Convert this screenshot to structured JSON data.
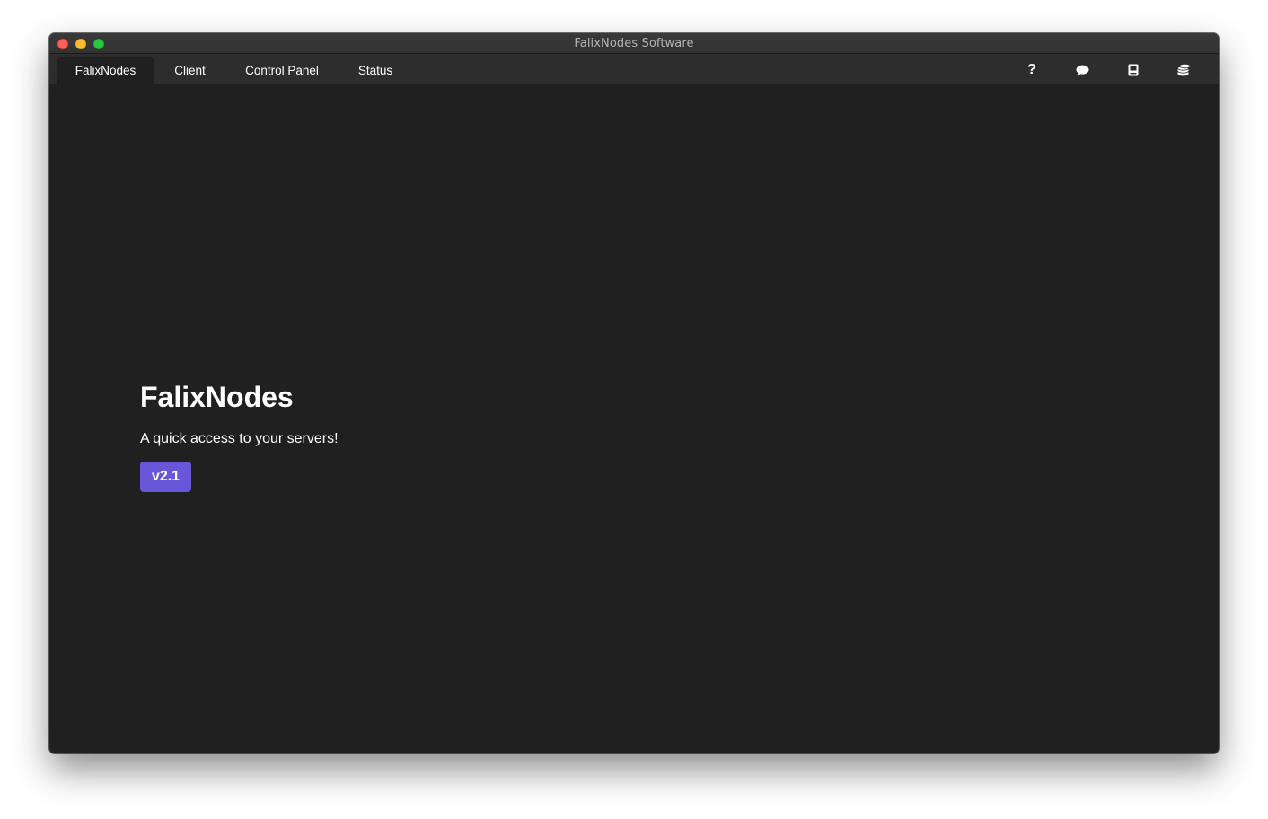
{
  "window": {
    "title": "FalixNodes Software"
  },
  "nav": {
    "tabs": [
      {
        "label": "FalixNodes",
        "active": true
      },
      {
        "label": "Client",
        "active": false
      },
      {
        "label": "Control Panel",
        "active": false
      },
      {
        "label": "Status",
        "active": false
      }
    ],
    "icons": [
      "help-icon",
      "chat-icon",
      "book-icon",
      "database-icon"
    ]
  },
  "main": {
    "heading": "FalixNodes",
    "subtitle": "A quick access to your servers!",
    "version": "v2.1"
  },
  "colors": {
    "accent": "#6a56d8",
    "background": "#202020",
    "navbar": "#2d2d2d"
  }
}
